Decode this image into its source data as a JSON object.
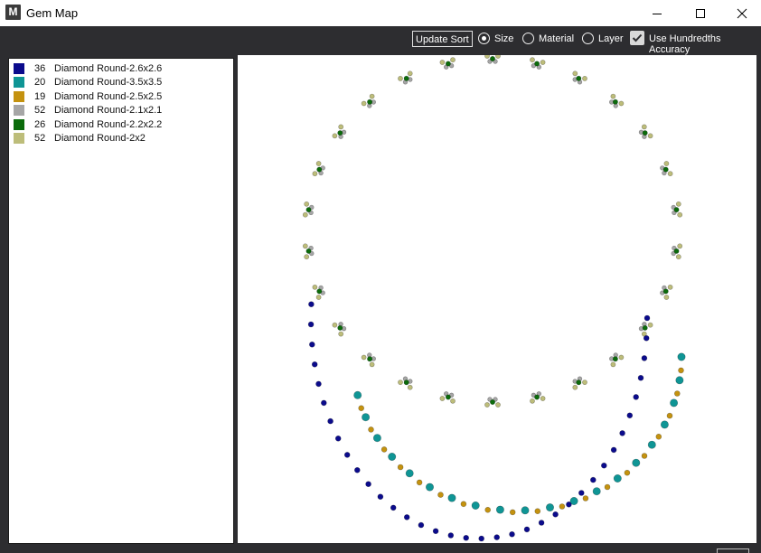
{
  "window": {
    "title": "Gem Map",
    "app_icon_letter": "M"
  },
  "toolbar": {
    "update_sort_label": "Update Sort",
    "sort_options": [
      {
        "label": "Size",
        "selected": true
      },
      {
        "label": "Material",
        "selected": false
      },
      {
        "label": "Layer",
        "selected": false
      }
    ],
    "hundredths_label": "Use Hundredths Accuracy",
    "hundredths_checked": true
  },
  "legend": {
    "items": [
      {
        "count": "36",
        "name": "Diamond Round-2.6x2.6",
        "color": "#0b0b8c"
      },
      {
        "count": "20",
        "name": "Diamond Round-3.5x3.5",
        "color": "#0f9595"
      },
      {
        "count": "19",
        "name": "Diamond Round-2.5x2.5",
        "color": "#c4920f"
      },
      {
        "count": "52",
        "name": "Diamond Round-2.1x2.1",
        "color": "#a6a6a6"
      },
      {
        "count": "26",
        "name": "Diamond Round-2.2x2.2",
        "color": "#0b6b0b"
      },
      {
        "count": "52",
        "name": "Diamond Round-2x2",
        "color": "#bdbd7a"
      }
    ]
  },
  "colors": {
    "titlebar_bg": "#ffffff",
    "chrome_bg": "#2d2d30",
    "map_bg": "#ffffff"
  }
}
